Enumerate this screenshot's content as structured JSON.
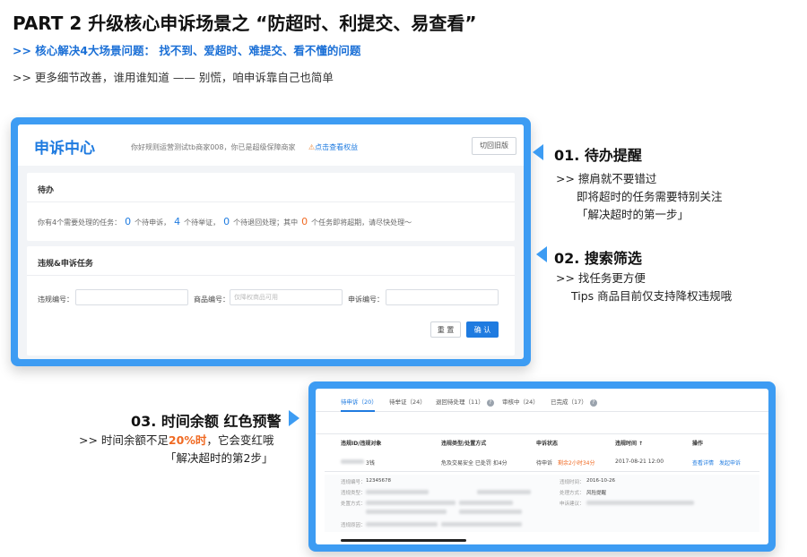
{
  "header": {
    "title": "PART 2 升级核心申诉场景之 “防超时、利提交、易查看”",
    "subtitle": ">> 核心解决4大场景问题：  找不到、爱超时、难提交、看不懂的问题",
    "note": ">> 更多细节改善，谁用谁知道 —— 别慌，咱申诉靠自己也简单"
  },
  "panel1": {
    "app_title": "申诉中心",
    "greeting": "你好规则运营测试tb商家008，你已是超级保障商家",
    "rights_icon": "warning-icon",
    "rights_link": "点击查看权益",
    "switch_old": "切回旧版",
    "todo": {
      "title": "待办",
      "line_prefix": "你有4个需要处理的任务：",
      "count_appeal": "0",
      "label_appeal": "个待申诉，",
      "count_proof": "4",
      "label_proof": "个待举证，",
      "count_returned": "0",
      "label_returned": "个待退回处理；其中",
      "count_expiring": "0",
      "label_expiring": "个任务即将超期，请尽快处理～"
    },
    "search": {
      "title": "违规&申诉任务",
      "violation_label": "违规编号：",
      "violation_value": "",
      "product_label": "商品编号：",
      "product_placeholder": "仅降权商品可用",
      "appeal_label": "申诉编号：",
      "appeal_value": "",
      "reset": "重 置",
      "confirm": "确 认"
    }
  },
  "callouts": {
    "c1": {
      "title": "01. 待办提醒",
      "lines": [
        ">> 擦肩就不要错过",
        "即将超时的任务需要特别关注",
        "「解决超时的第一步」"
      ]
    },
    "c2": {
      "title": "02. 搜索筛选",
      "lines": [
        ">> 找任务更方便",
        "Tips 商品目前仅支持降权违规哦"
      ]
    },
    "c3": {
      "title": "03. 时间余额 红色预警",
      "line1_prefix": ">> 时间余额不足",
      "line1_highlight": "20%时",
      "line1_suffix": "，它会变红哦",
      "line2": "「解决超时的第2步」"
    }
  },
  "panel2": {
    "tabs": [
      "待申诉（20）",
      "待举证（24）",
      "退回待处理（11）",
      "审核中（24）",
      "已完成（17）"
    ],
    "columns": [
      "违规ID/违规对象",
      "违规类型/处置方式",
      "申诉状态",
      "违规时间 ↑",
      "操作"
    ],
    "row": {
      "object_suffix": "3钱",
      "type": "危及交易安全  已处罚  扣4分",
      "status": "待申诉",
      "remaining": "剩余2小时34分",
      "time": "2017-08-21 12:00",
      "action_detail": "查看详情",
      "action_appeal": "发起申诉"
    },
    "details": {
      "k1": "违规编号：",
      "v1": "12345678",
      "k2": "违规类型：",
      "k3": "处置方式：",
      "k4": "违规原因：",
      "k5": "违规时间：",
      "v5": "2016-10-26",
      "k6": "处理方式：",
      "v6": "风险提醒",
      "k7": "申诉建议："
    }
  }
}
